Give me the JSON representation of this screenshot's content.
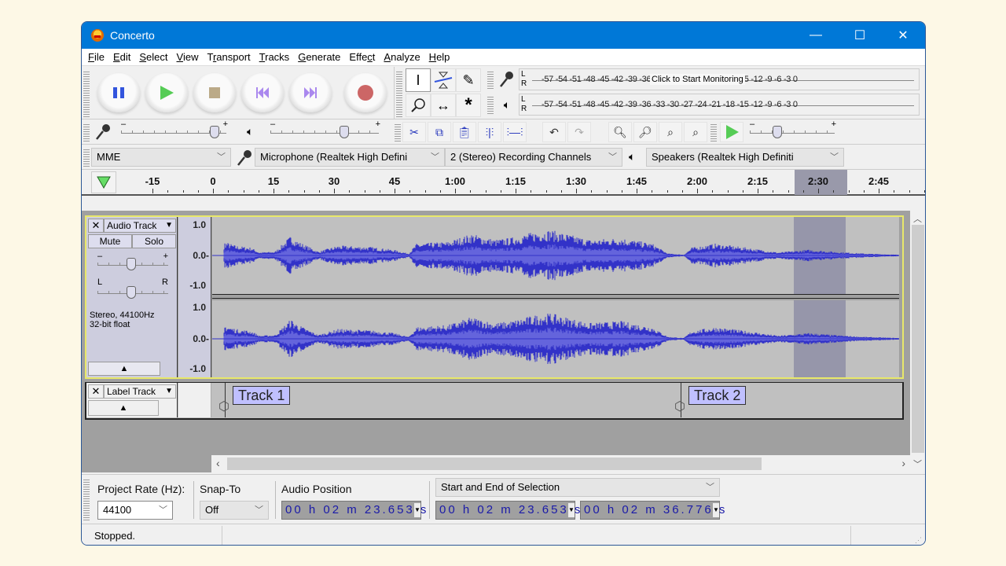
{
  "window": {
    "title": "Concerto",
    "controls": {
      "minimize": "—",
      "maximize": "☐",
      "close": "✕"
    }
  },
  "menu": [
    {
      "pre": "",
      "key": "F",
      "post": "ile"
    },
    {
      "pre": "",
      "key": "E",
      "post": "dit"
    },
    {
      "pre": "",
      "key": "S",
      "post": "elect"
    },
    {
      "pre": "",
      "key": "V",
      "post": "iew"
    },
    {
      "pre": "T",
      "key": "r",
      "post": "ansport"
    },
    {
      "pre": "",
      "key": "T",
      "post": "racks"
    },
    {
      "pre": "",
      "key": "G",
      "post": "enerate"
    },
    {
      "pre": "Effe",
      "key": "c",
      "post": "t"
    },
    {
      "pre": "",
      "key": "A",
      "post": "nalyze"
    },
    {
      "pre": "",
      "key": "H",
      "post": "elp"
    }
  ],
  "transport": {
    "buttons": [
      "pause",
      "play",
      "stop",
      "skip-to-start",
      "skip-to-end",
      "record"
    ],
    "colors": {
      "pause": "#3355dd",
      "play": "#55cc55",
      "stop": "#bbaa88",
      "skip": "#aa88ee",
      "record": "#cc6666"
    }
  },
  "tools": [
    "selection",
    "envelope",
    "draw",
    "zoom",
    "time-shift",
    "multi"
  ],
  "meters": {
    "recording_scale": "-57 -54 -51 -48 -45 -42 -39 -36 -33 -30 -27 -24 -21 -18 -15 -12  -9   -6   -3   0",
    "playback_scale": "-57 -54 -51 -48 -45 -42 -39 -36 -33 -30 -27 -24 -21 -18 -15 -12  -9   -6   -3   0",
    "monitor_tip": "Click to Start Monitoring",
    "L": "L",
    "R": "R"
  },
  "mixer": {
    "recording_volume": 0.93,
    "playback_volume": 0.7,
    "play_at_speed": 0.3,
    "minus": "–",
    "plus": "+"
  },
  "devices": {
    "host": "MME",
    "mic": "Microphone (Realtek High Defini",
    "channels": "2 (Stereo) Recording Channels",
    "speakers": "Speakers (Realtek High Definiti"
  },
  "ruler": {
    "labels": [
      "-15",
      "0",
      "15",
      "30",
      "45",
      "1:00",
      "1:15",
      "1:30",
      "1:45",
      "2:00",
      "2:15",
      "2:30",
      "2:45"
    ]
  },
  "audio_track": {
    "name": "Audio Track",
    "mute": "Mute",
    "solo": "Solo",
    "gain_minus": "–",
    "gain_plus": "+",
    "pan_left": "L",
    "pan_right": "R",
    "gain": 0.48,
    "pan": 0.48,
    "info_line1": "Stereo, 44100Hz",
    "info_line2": "32-bit float",
    "scale": [
      "1.0",
      "0.0-",
      "-1.0"
    ],
    "wave_color": "#3232c8",
    "wave_rms_color": "#6464dc",
    "selection_start": "00 h 02 m 23.653 s",
    "selection_end": "00 h 02 m 36.776 s"
  },
  "label_track": {
    "name": "Label Track",
    "labels": [
      "Track 1",
      "Track 2"
    ]
  },
  "selection_toolbar": {
    "project_rate_label": "Project Rate (Hz):",
    "project_rate": "44100",
    "snap_label": "Snap-To",
    "snap_value": "Off",
    "audio_position_label": "Audio Position",
    "audio_position": "00 h 02 m 23.653 s",
    "selection_mode": "Start and End of Selection",
    "sel_start": "00 h 02 m 23.653 s",
    "sel_end": "00 h 02 m 36.776 s"
  },
  "status": {
    "text": "Stopped."
  }
}
